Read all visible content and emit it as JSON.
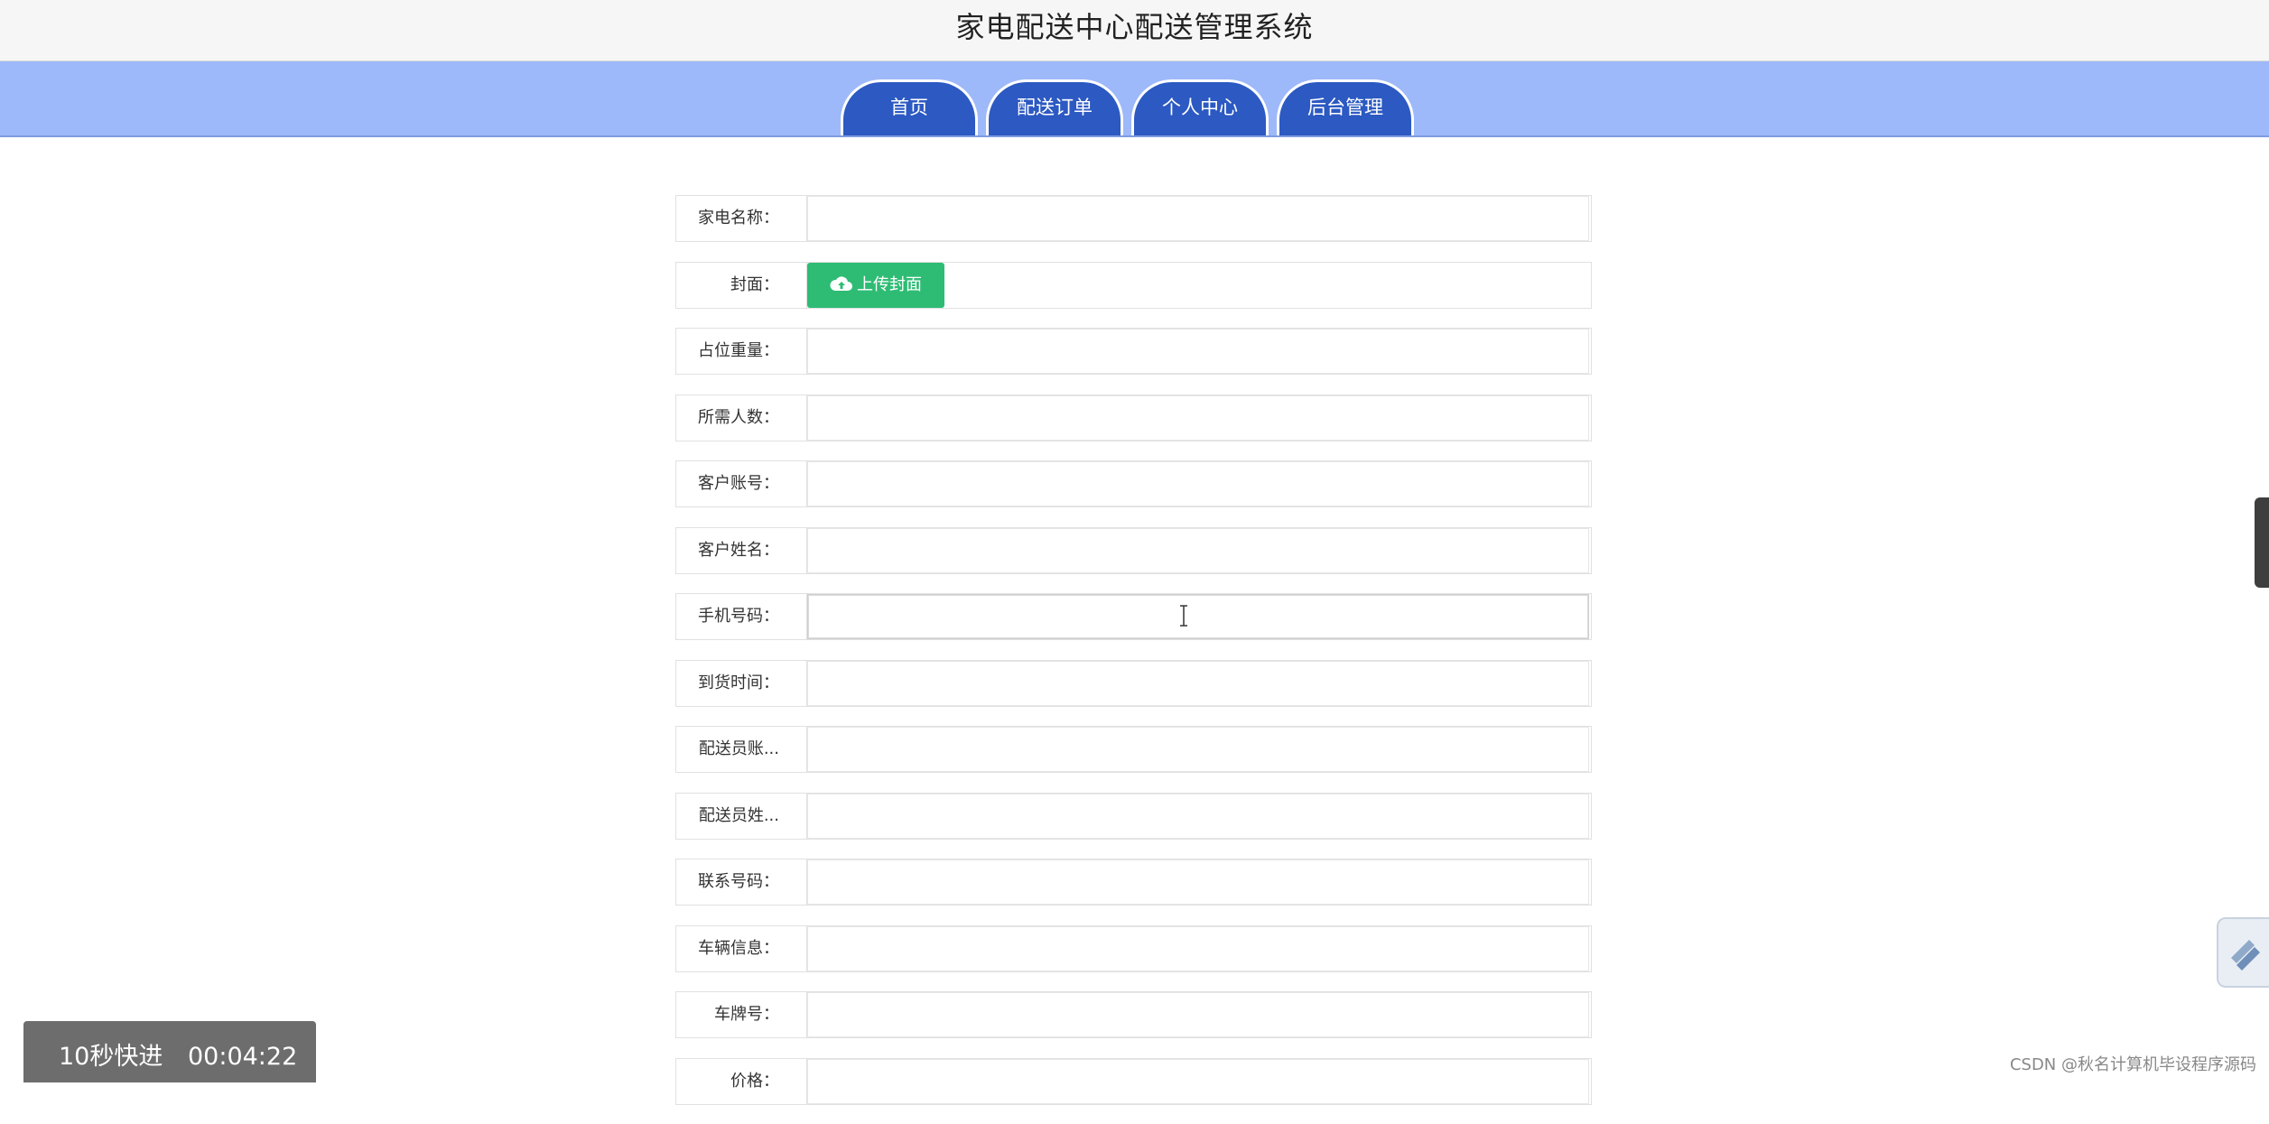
{
  "header": {
    "title": "家电配送中心配送管理系统"
  },
  "nav": {
    "tabs": [
      {
        "label": "首页"
      },
      {
        "label": "配送订单"
      },
      {
        "label": "个人中心"
      },
      {
        "label": "后台管理"
      }
    ]
  },
  "form": {
    "fields": [
      {
        "label": "家电名称：",
        "value": ""
      },
      {
        "label": "封面：",
        "button": "上传封面"
      },
      {
        "label": "占位重量：",
        "value": ""
      },
      {
        "label": "所需人数：",
        "value": ""
      },
      {
        "label": "客户账号：",
        "value": ""
      },
      {
        "label": "客户姓名：",
        "value": ""
      },
      {
        "label": "手机号码：",
        "value": ""
      },
      {
        "label": "到货时间：",
        "value": ""
      },
      {
        "label": "配送员账...",
        "value": ""
      },
      {
        "label": "配送员姓...",
        "value": ""
      },
      {
        "label": "联系号码：",
        "value": ""
      },
      {
        "label": "车辆信息：",
        "value": ""
      },
      {
        "label": "车牌号：",
        "value": ""
      },
      {
        "label": "价格：",
        "value": ""
      }
    ]
  },
  "overlay": {
    "speed": "10秒快进",
    "time": "00:04:22"
  },
  "watermark": "CSDN @秋名计算机毕设程序源码",
  "colors": {
    "nav_band": "#9eb9f9",
    "tab": "#2c59c2",
    "upload_button": "#2ebc74"
  },
  "icons": {
    "upload": "cloud-upload-icon",
    "cursor": "text-cursor-icon",
    "float": "brand-float-icon"
  }
}
